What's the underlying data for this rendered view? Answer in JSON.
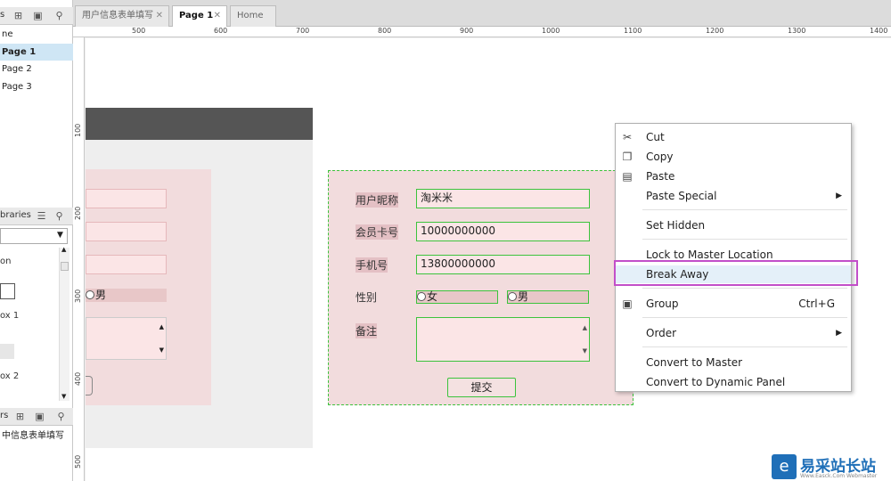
{
  "pages_panel": {
    "title": "s",
    "items": [
      {
        "label": "ne",
        "selected": false
      },
      {
        "label": "Page 1",
        "selected": true
      },
      {
        "label": "Page 2",
        "selected": false
      },
      {
        "label": "Page 3",
        "selected": false
      }
    ]
  },
  "libraries_panel": {
    "title": "braries",
    "items": [
      "on",
      "ox 1",
      "ox 2"
    ]
  },
  "masters_panel": {
    "title": "rs",
    "item": "中信息表单填写"
  },
  "tabs": [
    {
      "label": "用户信息表单填写",
      "active": false
    },
    {
      "label": "Page 1",
      "active": true
    },
    {
      "label": "Home",
      "active": false
    }
  ],
  "ruler_h": [
    "500",
    "600",
    "700",
    "800",
    "900",
    "1000",
    "1100",
    "1200",
    "1300",
    "1400"
  ],
  "ruler_v": [
    "100",
    "200",
    "300",
    "400",
    "500"
  ],
  "left_form": {
    "radio_male": "男"
  },
  "form": {
    "nickname_label": "用户昵称",
    "nickname_value": "淘米米",
    "card_label": "会员卡号",
    "card_value": "10000000000",
    "phone_label": "手机号",
    "phone_value": "13800000000",
    "gender_label": "性别",
    "gender_female": "女",
    "gender_male": "男",
    "note_label": "备注",
    "submit_label": "提交"
  },
  "context_menu": {
    "cut": "Cut",
    "copy": "Copy",
    "paste": "Paste",
    "paste_special": "Paste Special",
    "set_hidden": "Set Hidden",
    "lock_master": "Lock to Master Location",
    "break_away": "Break Away",
    "group": "Group",
    "group_shortcut": "Ctrl+G",
    "order": "Order",
    "convert_master": "Convert to Master",
    "convert_panel": "Convert to Dynamic Panel"
  },
  "watermark": {
    "text": "易采站长站",
    "sub": "Www.Easck.Com Webmaster"
  },
  "colors": {
    "highlight_border": "#c24fc9",
    "input_border": "#3cc33c",
    "form_bg": "#f2dcdd",
    "header_bar": "#555555"
  }
}
